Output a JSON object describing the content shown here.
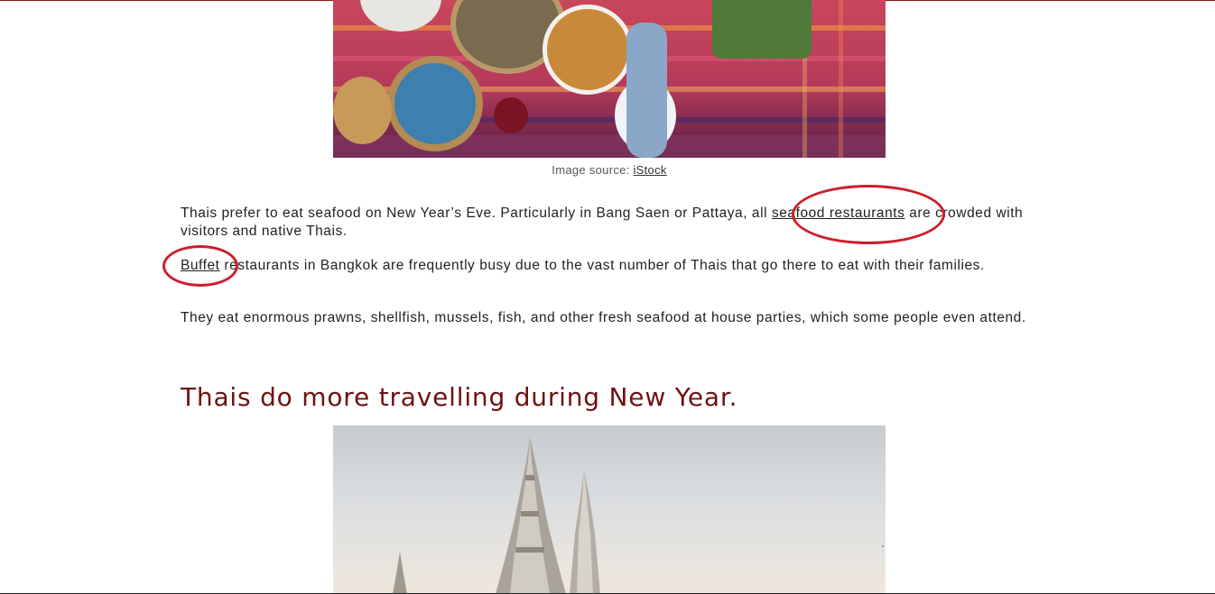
{
  "food_image": {
    "alt": "Thai food spread on a colorful striped tablecloth"
  },
  "caption": {
    "prefix": "Image source: ",
    "link": "iStock"
  },
  "paragraphs": {
    "p1_before": "Thais prefer to eat seafood on New Year’s Eve. Particularly in Bang Saen or Pattaya, all ",
    "p1_link": "seafood restaurants",
    "p1_after": " are crowded with visitors and native Thais.",
    "p2_link": "Buffet",
    "p2_after": " restaurants in Bangkok are frequently busy due to the vast number of Thais that go there to eat with their families.",
    "p3": "They eat enormous prawns, shellfish, mussels, fish, and other fresh seafood at house parties, which some people even attend."
  },
  "heading": "Thais do more travelling during New Year.",
  "temple_image": {
    "alt": "Temple spires against a pale sky"
  },
  "colors": {
    "heading": "#6e1212",
    "annotation_circle": "#cc1f2a"
  }
}
